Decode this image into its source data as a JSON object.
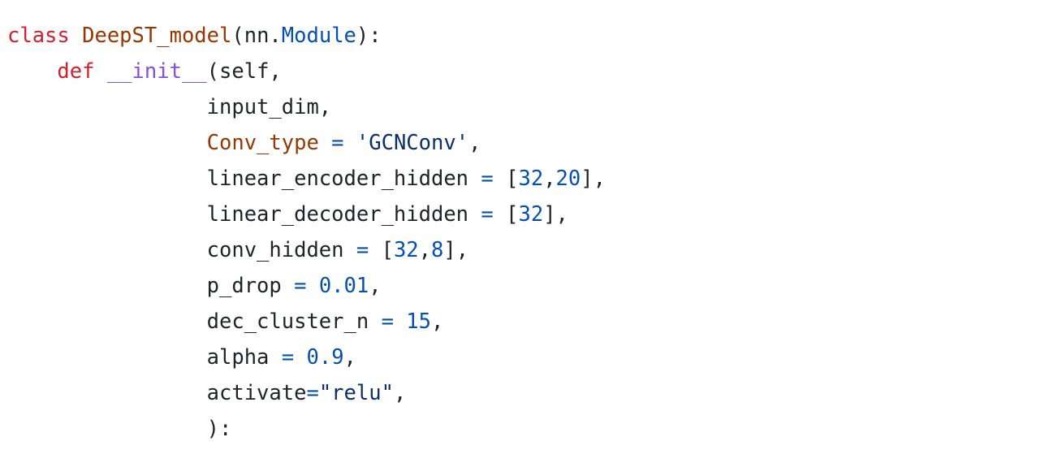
{
  "colors": {
    "text": "#1f2328",
    "keyword": "#cf222e",
    "class_name": "#953800",
    "builtin": "#0550ae",
    "function": "#8250df",
    "number": "#0550ae",
    "string": "#0a3069",
    "operator": "#0550ae"
  },
  "code": {
    "language": "python",
    "lines": [
      [
        {
          "text": "class",
          "type": "keyword"
        },
        {
          "text": " ",
          "type": "plain"
        },
        {
          "text": "DeepST_model",
          "type": "class_name"
        },
        {
          "text": "(nn.",
          "type": "plain"
        },
        {
          "text": "Module",
          "type": "builtin"
        },
        {
          "text": "):",
          "type": "plain"
        }
      ],
      [
        {
          "text": "    ",
          "type": "plain"
        },
        {
          "text": "def",
          "type": "keyword"
        },
        {
          "text": " ",
          "type": "plain"
        },
        {
          "text": "__init__",
          "type": "function"
        },
        {
          "text": "(self,",
          "type": "plain"
        }
      ],
      [
        {
          "text": "                input_dim,",
          "type": "plain"
        }
      ],
      [
        {
          "text": "                ",
          "type": "plain"
        },
        {
          "text": "Conv_type",
          "type": "class_name"
        },
        {
          "text": " ",
          "type": "plain"
        },
        {
          "text": "=",
          "type": "operator"
        },
        {
          "text": " ",
          "type": "plain"
        },
        {
          "text": "'GCNConv'",
          "type": "string"
        },
        {
          "text": ",",
          "type": "plain"
        }
      ],
      [
        {
          "text": "                linear_encoder_hidden ",
          "type": "plain"
        },
        {
          "text": "=",
          "type": "operator"
        },
        {
          "text": " [",
          "type": "plain"
        },
        {
          "text": "32",
          "type": "number"
        },
        {
          "text": ",",
          "type": "plain"
        },
        {
          "text": "20",
          "type": "number"
        },
        {
          "text": "],",
          "type": "plain"
        }
      ],
      [
        {
          "text": "                linear_decoder_hidden ",
          "type": "plain"
        },
        {
          "text": "=",
          "type": "operator"
        },
        {
          "text": " [",
          "type": "plain"
        },
        {
          "text": "32",
          "type": "number"
        },
        {
          "text": "],",
          "type": "plain"
        }
      ],
      [
        {
          "text": "                conv_hidden ",
          "type": "plain"
        },
        {
          "text": "=",
          "type": "operator"
        },
        {
          "text": " [",
          "type": "plain"
        },
        {
          "text": "32",
          "type": "number"
        },
        {
          "text": ",",
          "type": "plain"
        },
        {
          "text": "8",
          "type": "number"
        },
        {
          "text": "],",
          "type": "plain"
        }
      ],
      [
        {
          "text": "                p_drop ",
          "type": "plain"
        },
        {
          "text": "=",
          "type": "operator"
        },
        {
          "text": " ",
          "type": "plain"
        },
        {
          "text": "0.01",
          "type": "number"
        },
        {
          "text": ",",
          "type": "plain"
        }
      ],
      [
        {
          "text": "                dec_cluster_n ",
          "type": "plain"
        },
        {
          "text": "=",
          "type": "operator"
        },
        {
          "text": " ",
          "type": "plain"
        },
        {
          "text": "15",
          "type": "number"
        },
        {
          "text": ",",
          "type": "plain"
        }
      ],
      [
        {
          "text": "                alpha ",
          "type": "plain"
        },
        {
          "text": "=",
          "type": "operator"
        },
        {
          "text": " ",
          "type": "plain"
        },
        {
          "text": "0.9",
          "type": "number"
        },
        {
          "text": ",",
          "type": "plain"
        }
      ],
      [
        {
          "text": "                activate",
          "type": "plain"
        },
        {
          "text": "=",
          "type": "operator"
        },
        {
          "text": "\"relu\"",
          "type": "string"
        },
        {
          "text": ",",
          "type": "plain"
        }
      ],
      [
        {
          "text": "                ):",
          "type": "plain"
        }
      ]
    ]
  }
}
